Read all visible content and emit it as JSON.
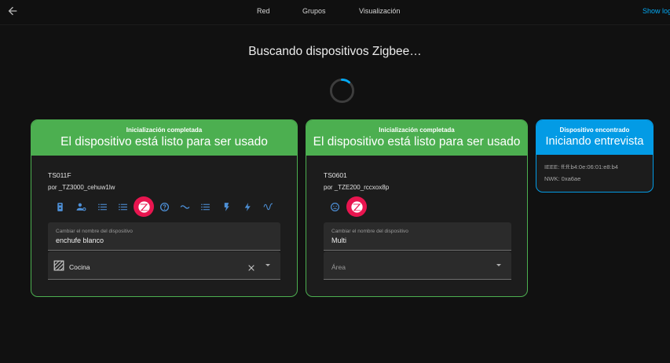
{
  "toolbar": {
    "back_icon": "arrow-left-icon",
    "tabs": [
      "Red",
      "Grupos",
      "Visualización"
    ],
    "show_logs": "Show logs"
  },
  "status": {
    "searching": "Buscando dispositivos Zigbee…"
  },
  "cards": [
    {
      "state": "Inicialización completada",
      "headline": "El dispositivo está listo para ser usado",
      "model": "TS011F",
      "by": "por _TZ3000_cehuw1lw",
      "icons": [
        "remote-icon",
        "user-settings-icon",
        "list-icon",
        "list-icon",
        "zigbee-logo",
        "help-icon",
        "wave-icon",
        "list-icon",
        "flash-icon",
        "bolt-icon",
        "sine-wave-icon"
      ],
      "rename_label": "Cambiar el nombre del dispositivo",
      "rename_value": "enchufe blanco",
      "area_value": "Cocina",
      "area_icon": "hatched-area-icon",
      "clear_icon": "close-icon"
    },
    {
      "state": "Inicialización completada",
      "headline": "El dispositivo está listo para ser usado",
      "model": "TS0601",
      "by": "por _TZE200_rccxox8p",
      "icons": [
        "face-sad-icon",
        "zigbee-logo"
      ],
      "rename_label": "Cambiar el nombre del dispositivo",
      "rename_value": "Multi",
      "area_placeholder": "Área"
    },
    {
      "state": "Dispositivo encontrado",
      "headline": "Iniciando entrevista",
      "ieee": "IEEE: ff:ff:b4:0e:06:01:e8:b4",
      "nwk": "NWK: 0xa6ae"
    }
  ],
  "colors": {
    "success": "#4caf50",
    "info": "#039be5",
    "icon_accent": "#4d8fd6",
    "zigbee": "#e8154f",
    "background": "#111111",
    "card": "#1c1c1c"
  }
}
